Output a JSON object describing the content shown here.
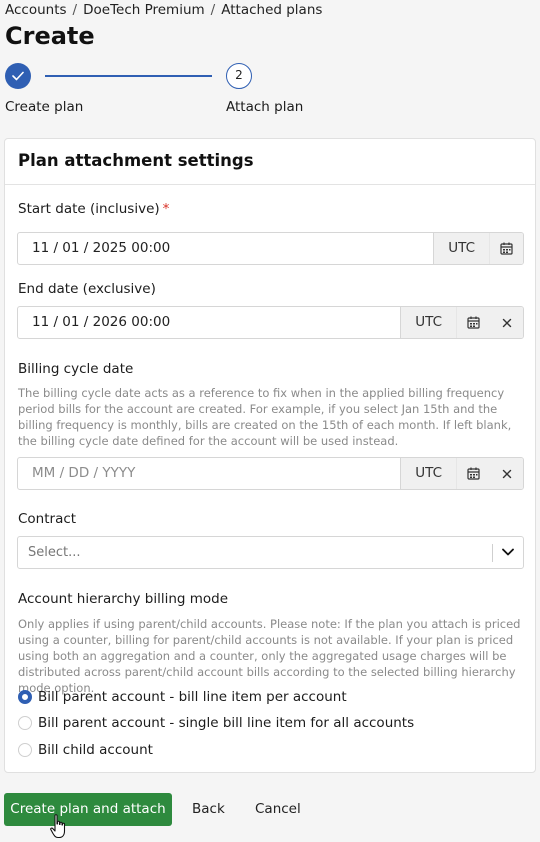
{
  "breadcrumb": {
    "items": [
      "Accounts",
      "DoeTech Premium",
      "Attached plans"
    ],
    "separator": "/"
  },
  "page": {
    "title": "Create"
  },
  "stepper": {
    "steps": [
      {
        "label": "Create plan",
        "state": "completed"
      },
      {
        "label": "Attach plan",
        "number": "2",
        "state": "current"
      }
    ]
  },
  "form": {
    "title": "Plan attachment settings",
    "start_date": {
      "label": "Start date (inclusive)",
      "required_mark": "*",
      "value": "11 / 01 / 2025 00:00",
      "timezone": "UTC"
    },
    "end_date": {
      "label": "End date (exclusive)",
      "value": "11 / 01 / 2026 00:00",
      "timezone": "UTC"
    },
    "billing_cycle_date": {
      "label": "Billing cycle date",
      "help": "The billing cycle date acts as a reference to fix when in the applied billing frequency period bills for the account are created. For example, if you select Jan 15th and the billing frequency is monthly, bills are created on the 15th of each month. If left blank, the billing cycle date defined for the account will be used instead.",
      "placeholder": "MM / DD / YYYY",
      "timezone": "UTC"
    },
    "contract": {
      "label": "Contract",
      "placeholder": "Select..."
    },
    "hierarchy_mode": {
      "label": "Account hierarchy billing mode",
      "help": "Only applies if using parent/child accounts. Please note: If the plan you attach is priced using a counter, billing for parent/child accounts is not available. If your plan is priced using both an aggregation and a counter, only the aggregated usage charges will be distributed across parent/child account bills according to the selected billing hierarchy mode option.",
      "options": [
        {
          "label": "Bill parent account - bill line item per account",
          "selected": true
        },
        {
          "label": "Bill parent account - single bill line item for all accounts",
          "selected": false
        },
        {
          "label": "Bill child account",
          "selected": false
        }
      ]
    }
  },
  "actions": {
    "primary": "Create plan and attach",
    "back": "Back",
    "cancel": "Cancel"
  },
  "colors": {
    "accent": "#2f5fb3",
    "primary_button": "#2e8a3e",
    "required": "#d93025"
  }
}
